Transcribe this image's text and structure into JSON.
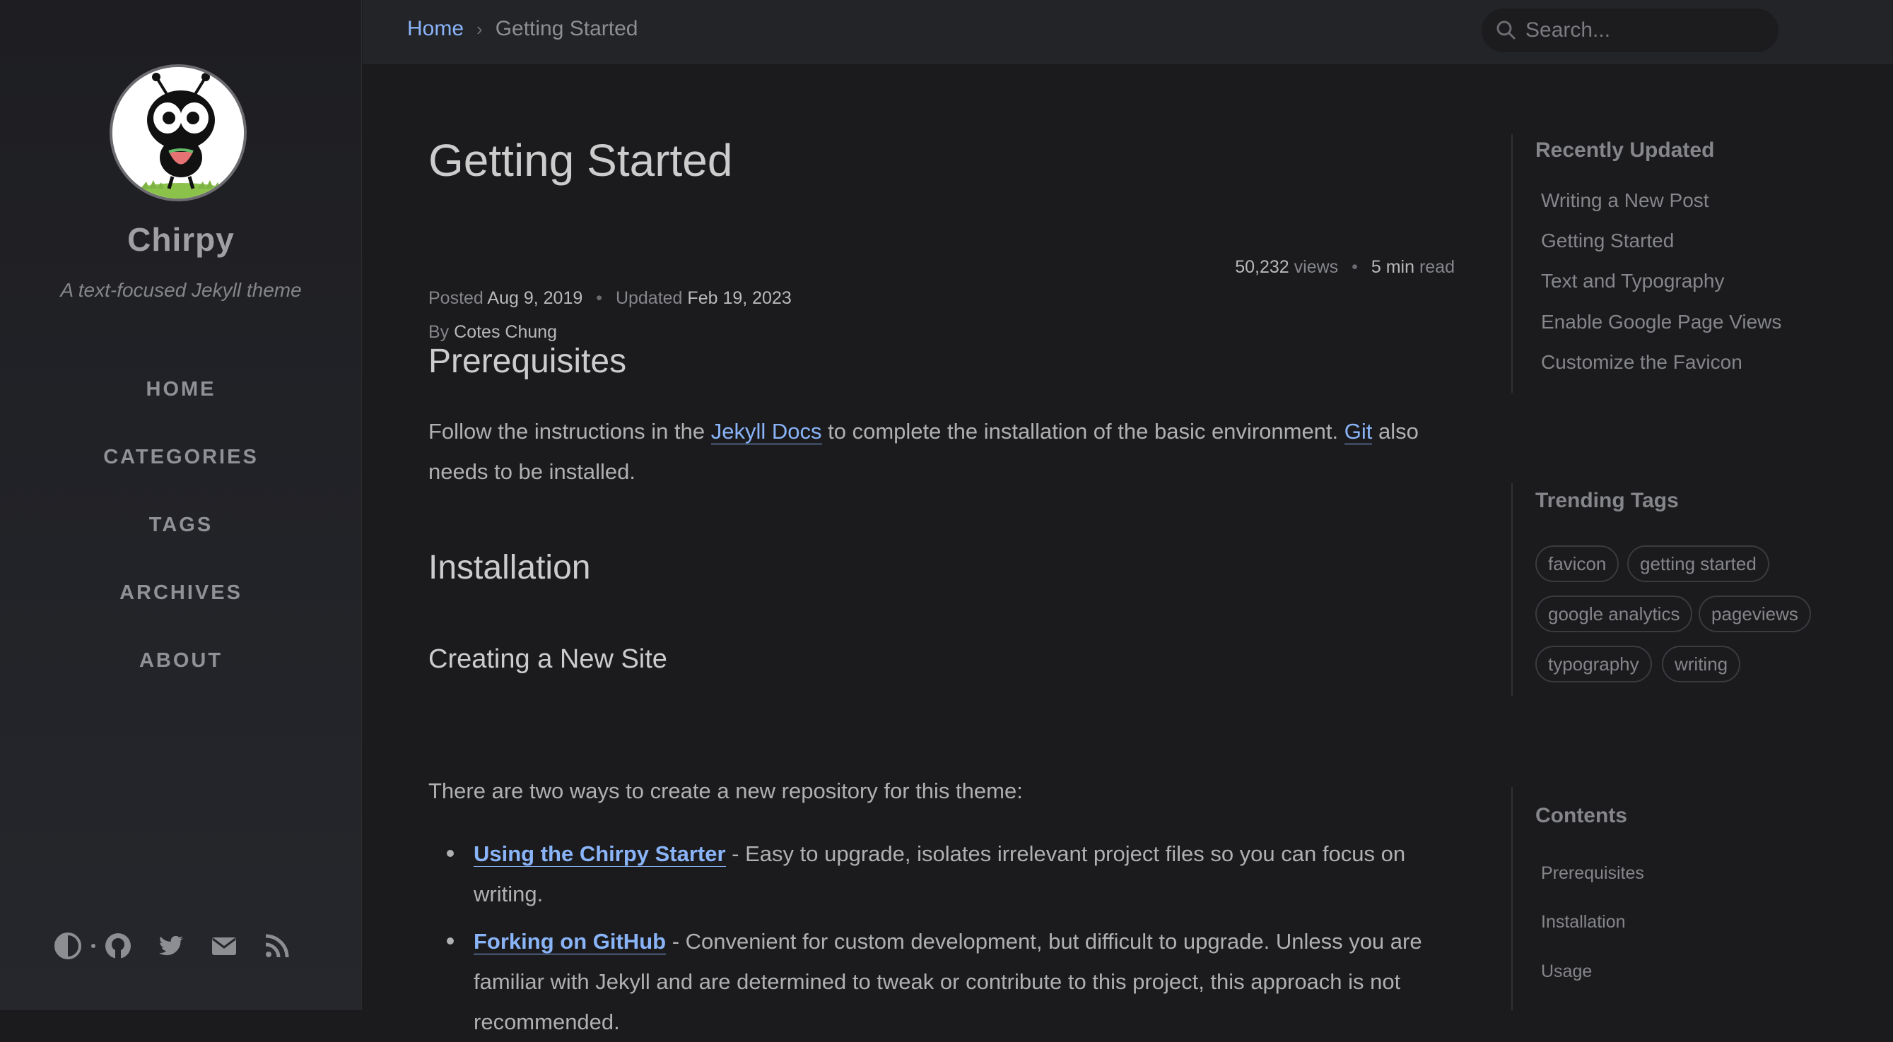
{
  "sidebar": {
    "site_title": "Chirpy",
    "site_subtitle": "A text-focused Jekyll theme",
    "nav": [
      "HOME",
      "CATEGORIES",
      "TAGS",
      "ARCHIVES",
      "ABOUT"
    ],
    "bottom_icons": [
      "theme-toggle-icon",
      "github-icon",
      "twitter-icon",
      "email-icon",
      "rss-icon"
    ]
  },
  "topbar": {
    "breadcrumb_home": "Home",
    "breadcrumb_sep": "›",
    "breadcrumb_current": "Getting Started",
    "search_placeholder": "Search..."
  },
  "post": {
    "title": "Getting Started",
    "posted_label": "Posted",
    "posted_date": "Aug 9, 2019",
    "updated_label": "Updated",
    "updated_date": "Feb 19, 2023",
    "by_label": "By",
    "author": "Cotes Chung",
    "views_count": "50,232",
    "views_label": "views",
    "read_time": "5 min",
    "read_label": "read"
  },
  "content": {
    "h_prereq": "Prerequisites",
    "p1_a": "Follow the instructions in the ",
    "p1_link1": "Jekyll Docs",
    "p1_b": " to complete the installation of the basic environment. ",
    "p1_link2": "Git",
    "p1_c": " also needs to be installed.",
    "h_install": "Installation",
    "h_create": "Creating a New Site",
    "p2": "There are two ways to create a new repository for this theme:",
    "li1_link": "Using the Chirpy Starter",
    "li1_text": " - Easy to upgrade, isolates irrelevant project files so you can focus on writing.",
    "li2_link": "Forking on GitHub",
    "li2_text": " - Convenient for custom development, but difficult to upgrade. Unless you are familiar with Jekyll and are determined to tweak or contribute to this project, this approach is not recommended."
  },
  "panel": {
    "recent_heading": "Recently Updated",
    "recent": [
      "Writing a New Post",
      "Getting Started",
      "Text and Typography",
      "Enable Google Page Views",
      "Customize the Favicon"
    ],
    "tags_heading": "Trending Tags",
    "tags": [
      "favicon",
      "getting started",
      "google analytics",
      "pageviews",
      "typography",
      "writing"
    ],
    "toc_heading": "Contents",
    "toc": [
      "Prerequisites",
      "Installation",
      "Usage"
    ]
  },
  "colors": {
    "accent_link": "#8ab4f8",
    "background": "#1b1b1e",
    "sidebar": "#1e1e22"
  }
}
